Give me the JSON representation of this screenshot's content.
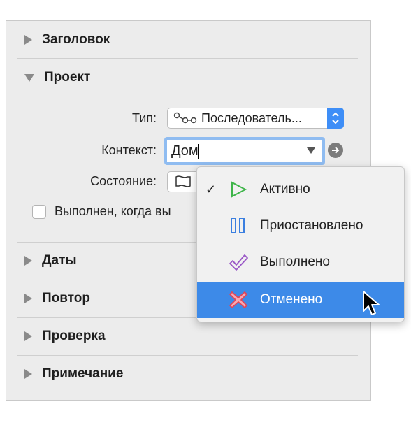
{
  "sections": {
    "header": "Заголовок",
    "project": "Проект",
    "dates": "Даты",
    "repeat": "Повтор",
    "review": "Проверка",
    "note": "Примечание"
  },
  "project": {
    "type_label": "Тип:",
    "type_value": "Последователь...",
    "context_label": "Контекст:",
    "context_value": "Дом",
    "status_label": "Состояние:",
    "complete_checkbox_label": "Выполнен, когда вы",
    "complete_checked": false
  },
  "status_menu": {
    "items": [
      {
        "label": "Активно",
        "icon": "play-icon",
        "color": "#3fb54a",
        "checked": true
      },
      {
        "label": "Приостановлено",
        "icon": "pause-icon",
        "color": "#3b7fe0",
        "checked": false
      },
      {
        "label": "Выполнено",
        "icon": "checkmark-icon",
        "color": "#9b59c7",
        "checked": false
      },
      {
        "label": "Отменено",
        "icon": "cross-icon",
        "color": "#e0465a",
        "checked": false,
        "highlighted": true
      }
    ],
    "check_glyph": "✓"
  },
  "colors": {
    "accent": "#3d8ae8",
    "panel_bg": "#ececec"
  }
}
